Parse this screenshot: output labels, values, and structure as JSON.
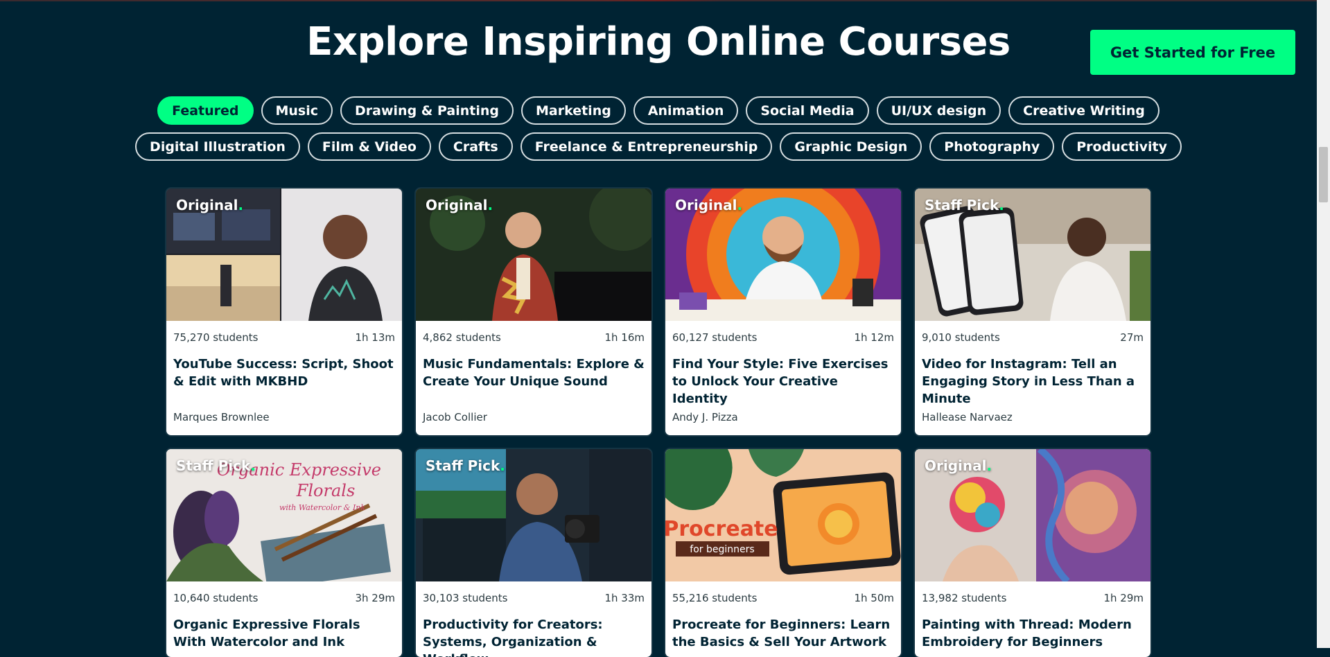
{
  "header": {
    "title": "Explore Inspiring Online Courses",
    "cta_label": "Get Started for Free"
  },
  "categories": {
    "row1": [
      "Featured",
      "Music",
      "Drawing & Painting",
      "Marketing",
      "Animation",
      "Social Media",
      "UI/UX design",
      "Creative Writing"
    ],
    "row2": [
      "Digital Illustration",
      "Film & Video",
      "Crafts",
      "Freelance & Entrepreneurship",
      "Graphic Design",
      "Photography",
      "Productivity"
    ],
    "selected": "Featured"
  },
  "courses": [
    {
      "badge": "Original",
      "students": "75,270 students",
      "duration": "1h 13m",
      "title": "YouTube Success: Script, Shoot & Edit with MKBHD",
      "teacher": "Marques Brownlee"
    },
    {
      "badge": "Original",
      "students": "4,862 students",
      "duration": "1h 16m",
      "title": "Music Fundamentals: Explore & Create Your Unique Sound",
      "teacher": "Jacob Collier"
    },
    {
      "badge": "Original",
      "students": "60,127 students",
      "duration": "1h 12m",
      "title": "Find Your Style: Five Exercises to Unlock Your Creative Identity",
      "teacher": "Andy J. Pizza"
    },
    {
      "badge": "Staff Pick",
      "students": "9,010 students",
      "duration": "27m",
      "title": "Video for Instagram: Tell an Engaging Story in Less Than a Minute",
      "teacher": "Hallease Narvaez"
    },
    {
      "badge": "Staff Pick",
      "students": "10,640 students",
      "duration": "3h 29m",
      "title": "Organic Expressive Florals With Watercolor and Ink",
      "teacher": ""
    },
    {
      "badge": "Staff Pick",
      "students": "30,103 students",
      "duration": "1h 33m",
      "title": "Productivity for Creators: Systems, Organization & Workflow",
      "teacher": ""
    },
    {
      "badge": "",
      "students": "55,216 students",
      "duration": "1h 50m",
      "title": "Procreate for Beginners: Learn the Basics & Sell Your Artwork",
      "teacher": ""
    },
    {
      "badge": "Original",
      "students": "13,982 students",
      "duration": "1h 29m",
      "title": "Painting with Thread: Modern Embroidery for Beginners",
      "teacher": ""
    }
  ],
  "thumb_text": {
    "florals_line1": "Organic Expressive",
    "florals_line2": "Florals",
    "florals_line3": "with Watercolor & Ink",
    "procreate_line1": "Procreate",
    "procreate_line2": "for beginners"
  },
  "colors": {
    "background": "#002333",
    "accent": "#00ff84",
    "card": "#ffffff",
    "text_dark": "#002333"
  }
}
